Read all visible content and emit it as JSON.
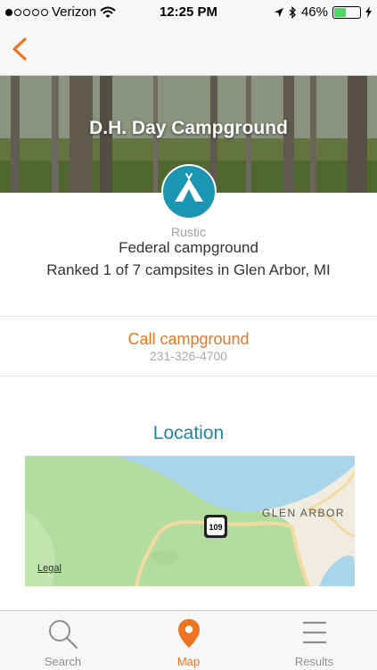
{
  "status_bar": {
    "carrier": "Verizon",
    "time": "12:25 PM",
    "battery": "46%",
    "battery_level": 0.46
  },
  "hero": {
    "title": "D.H. Day Campground"
  },
  "campground": {
    "type": "Rustic",
    "ownership": "Federal campground",
    "rank": "Ranked 1 of 7 campsites in Glen Arbor, MI"
  },
  "contact": {
    "call_label": "Call campground",
    "phone": "231-326-4700"
  },
  "location": {
    "title": "Location",
    "map_place": "GLEN ARBOR",
    "route_label": "109",
    "legal_label": "Legal"
  },
  "tabbar": {
    "tabs": [
      {
        "label": "Search",
        "icon": "search-icon"
      },
      {
        "label": "Map",
        "icon": "map-pin-icon",
        "active": true
      },
      {
        "label": "Results",
        "icon": "list-icon"
      }
    ]
  },
  "colors": {
    "accent": "#ec7421",
    "teal": "#1a8aa8"
  }
}
